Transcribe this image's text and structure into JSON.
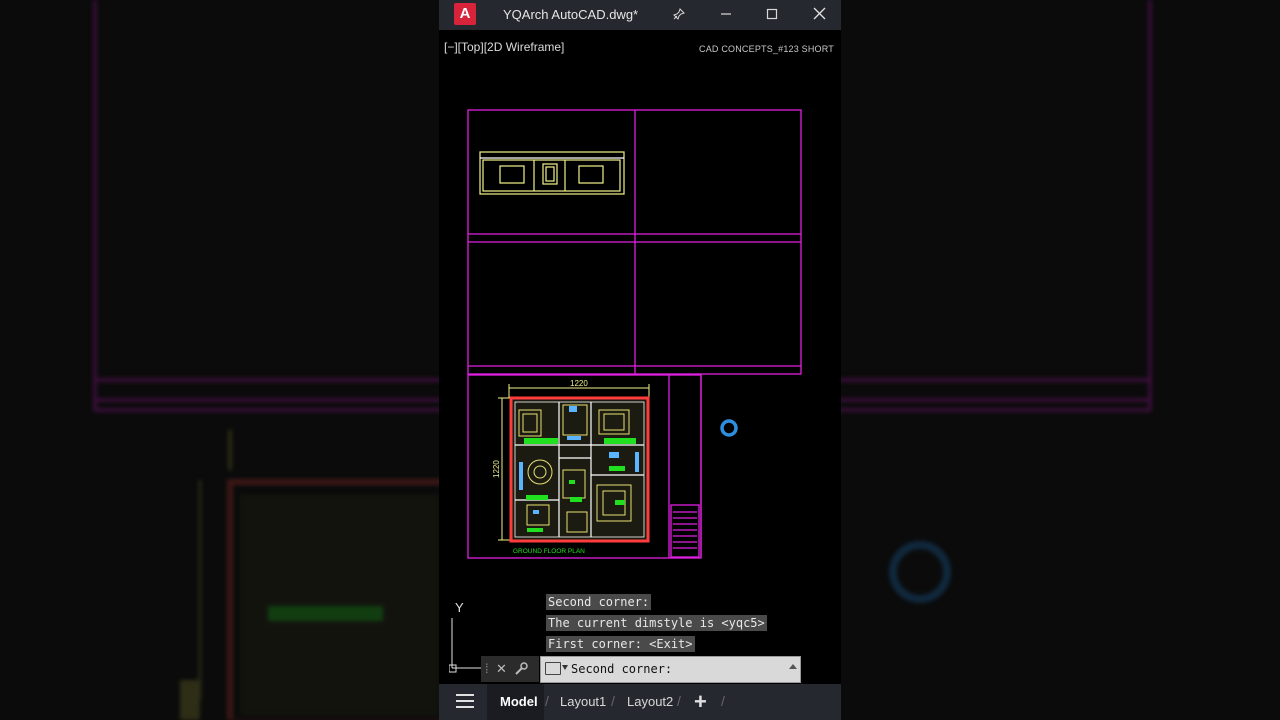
{
  "app": {
    "logo_letter": "A",
    "title": "YQArch AutoCAD.dwg*",
    "pin_icon": "pin-icon",
    "minimize_icon": "minimize-icon",
    "maximize_icon": "maximize-icon",
    "close_icon": "close-icon"
  },
  "viewport": {
    "label": "[−][Top][2D Wireframe]",
    "watermark": "CAD CONCEPTS_#123 SHORT"
  },
  "drawing": {
    "dimension_horizontal": "1220",
    "dimension_vertical": "1220",
    "plan_title": "GROUND FLOOR PLAN",
    "colors": {
      "frame": "#e020e0",
      "elevation": "#f2f28a",
      "walls": "#ff3c3c",
      "furniture": "#e8e070",
      "labels": "#20e020",
      "fixtures": "#5ab4ff",
      "dimension": "#f2f28a"
    }
  },
  "ucs": {
    "y_label": "Y"
  },
  "command_history": [
    "Second corner:",
    "The current dimstyle is <yqc5>",
    "First corner: <Exit>"
  ],
  "command_line": {
    "value": "Second corner:",
    "close_icon": "close-icon",
    "wrench_icon": "wrench-icon",
    "command-icon": "terminal-icon"
  },
  "tabs": [
    {
      "label": "Model",
      "active": true
    },
    {
      "label": "Layout1",
      "active": false
    },
    {
      "label": "Layout2",
      "active": false
    }
  ],
  "add_tab_label": "+"
}
